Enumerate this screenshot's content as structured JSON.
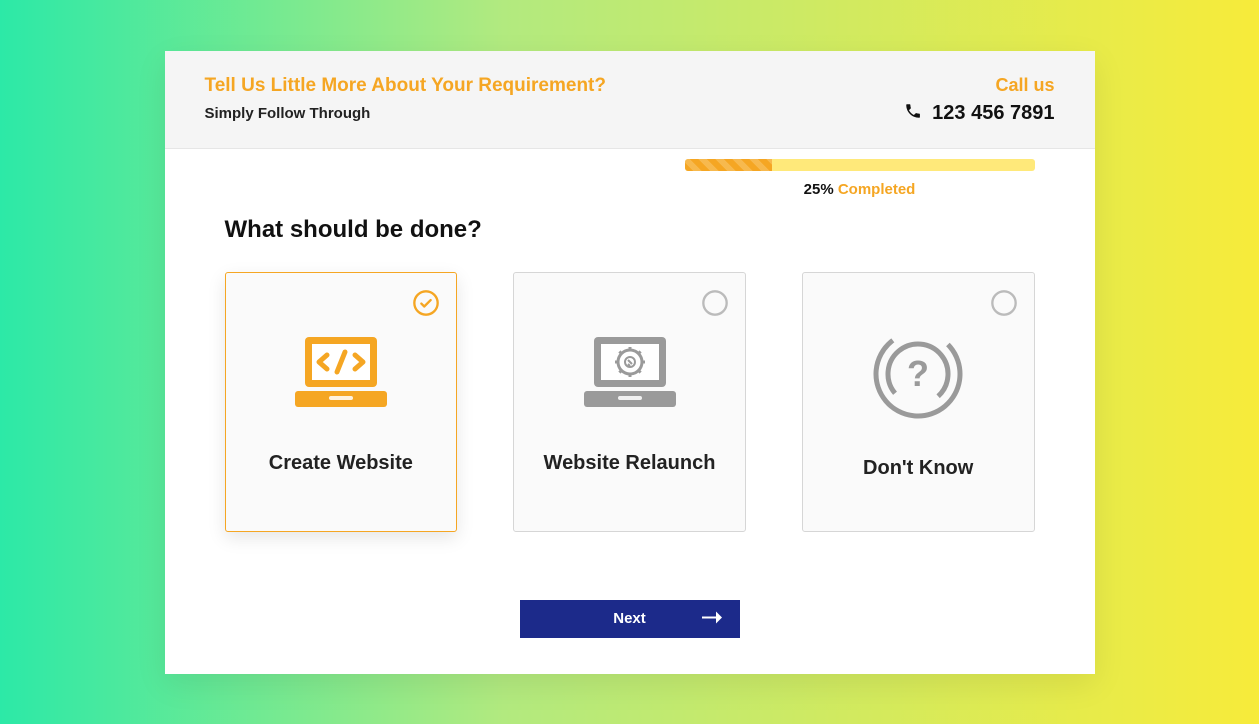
{
  "header": {
    "title": "Tell Us Little More About Your Requirement?",
    "subtitle": "Simply Follow Through",
    "callus_label": "Call us",
    "phone": "123 456 7891"
  },
  "progress": {
    "percent": "25%",
    "percent_value": 25,
    "label": "Completed"
  },
  "question": "What should be done?",
  "options": [
    {
      "label": "Create Website",
      "selected": true,
      "icon": "laptop-code"
    },
    {
      "label": "Website Relaunch",
      "selected": false,
      "icon": "laptop-gear"
    },
    {
      "label": "Don't Know",
      "selected": false,
      "icon": "question-circle"
    }
  ],
  "next_label": "Next"
}
